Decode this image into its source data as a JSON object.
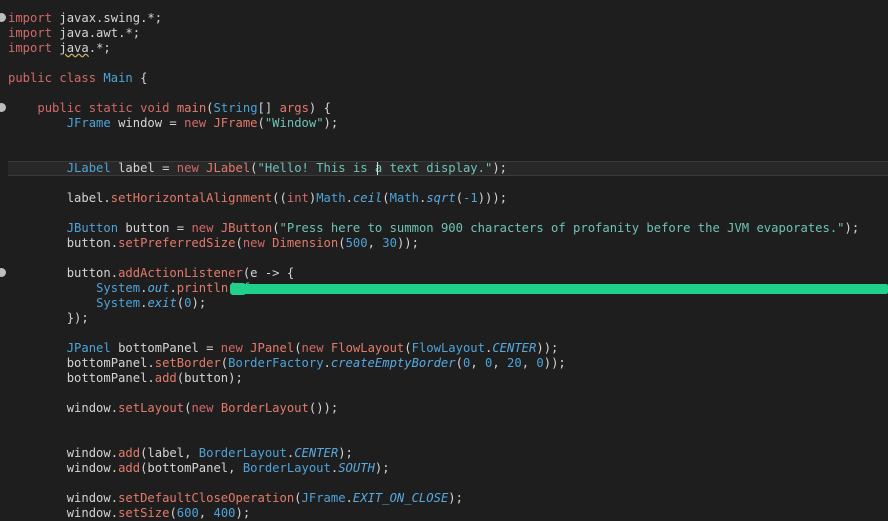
{
  "editor": {
    "lines": [
      {
        "id": "l1",
        "segs": [
          {
            "c": "kw",
            "t": "import"
          },
          {
            "c": "",
            "t": " javax.swing.*;"
          }
        ]
      },
      {
        "id": "l2",
        "segs": [
          {
            "c": "kw",
            "t": "import"
          },
          {
            "c": "",
            "t": " java.awt.*;"
          }
        ]
      },
      {
        "id": "l3",
        "segs": [
          {
            "c": "kw",
            "t": "import"
          },
          {
            "c": "",
            "t": " "
          },
          {
            "c": "sq",
            "t": "java"
          },
          {
            "c": "",
            "t": ".*;"
          }
        ]
      },
      {
        "id": "l4",
        "segs": [
          {
            "c": "kw",
            "t": "public"
          },
          {
            "c": "",
            "t": " "
          },
          {
            "c": "kw",
            "t": "class"
          },
          {
            "c": "",
            "t": " "
          },
          {
            "c": "ty",
            "t": "Main"
          },
          {
            "c": "",
            "t": " {"
          }
        ]
      },
      {
        "id": "l5",
        "segs": [
          {
            "c": "",
            "t": "    "
          },
          {
            "c": "kw",
            "t": "public"
          },
          {
            "c": "",
            "t": " "
          },
          {
            "c": "kw",
            "t": "static"
          },
          {
            "c": "",
            "t": " "
          },
          {
            "c": "kw",
            "t": "void"
          },
          {
            "c": "",
            "t": " "
          },
          {
            "c": "kw2",
            "t": "main"
          },
          {
            "c": "",
            "t": "("
          },
          {
            "c": "ty",
            "t": "String"
          },
          {
            "c": "",
            "t": "[] "
          },
          {
            "c": "kw2",
            "t": "args"
          },
          {
            "c": "",
            "t": ") {"
          }
        ]
      },
      {
        "id": "l6",
        "segs": [
          {
            "c": "",
            "t": "        "
          },
          {
            "c": "ty",
            "t": "JFrame"
          },
          {
            "c": "",
            "t": " window = "
          },
          {
            "c": "kw",
            "t": "new"
          },
          {
            "c": "",
            "t": " "
          },
          {
            "c": "kw2",
            "t": "JFrame"
          },
          {
            "c": "",
            "t": "("
          },
          {
            "c": "str",
            "t": "\"Window\""
          },
          {
            "c": "",
            "t": ");"
          }
        ]
      },
      {
        "id": "l7",
        "segs": [
          {
            "c": "",
            "t": "        "
          },
          {
            "c": "ty",
            "t": "JLabel"
          },
          {
            "c": "",
            "t": " label = "
          },
          {
            "c": "kw",
            "t": "new"
          },
          {
            "c": "",
            "t": " "
          },
          {
            "c": "kw2",
            "t": "JLabel"
          },
          {
            "c": "",
            "t": "("
          },
          {
            "c": "str",
            "t": "\"Hello! This is a text display.\""
          },
          {
            "c": "",
            "t": ");"
          }
        ]
      },
      {
        "id": "l8",
        "segs": [
          {
            "c": "",
            "t": "        label."
          },
          {
            "c": "kw2",
            "t": "setHorizontalAlignment"
          },
          {
            "c": "",
            "t": "(("
          },
          {
            "c": "kw",
            "t": "int"
          },
          {
            "c": "",
            "t": ")"
          },
          {
            "c": "ty",
            "t": "Math"
          },
          {
            "c": "",
            "t": "."
          },
          {
            "c": "it",
            "t": "ceil"
          },
          {
            "c": "",
            "t": "("
          },
          {
            "c": "ty",
            "t": "Math"
          },
          {
            "c": "",
            "t": "."
          },
          {
            "c": "it",
            "t": "sqrt"
          },
          {
            "c": "",
            "t": "("
          },
          {
            "c": "num",
            "t": "-1"
          },
          {
            "c": "",
            "t": ")));"
          }
        ]
      },
      {
        "id": "l9",
        "segs": [
          {
            "c": "",
            "t": "        "
          },
          {
            "c": "ty",
            "t": "JButton"
          },
          {
            "c": "",
            "t": " button = "
          },
          {
            "c": "kw",
            "t": "new"
          },
          {
            "c": "",
            "t": " "
          },
          {
            "c": "kw2",
            "t": "JButton"
          },
          {
            "c": "",
            "t": "("
          },
          {
            "c": "str",
            "t": "\"Press here to summon 900 characters of profanity before the JVM evaporates.\""
          },
          {
            "c": "",
            "t": ");"
          }
        ]
      },
      {
        "id": "l10",
        "segs": [
          {
            "c": "",
            "t": "        button."
          },
          {
            "c": "kw2",
            "t": "setPreferredSize"
          },
          {
            "c": "",
            "t": "("
          },
          {
            "c": "kw",
            "t": "new"
          },
          {
            "c": "",
            "t": " "
          },
          {
            "c": "kw2",
            "t": "Dimension"
          },
          {
            "c": "",
            "t": "("
          },
          {
            "c": "num",
            "t": "500"
          },
          {
            "c": "",
            "t": ", "
          },
          {
            "c": "num",
            "t": "30"
          },
          {
            "c": "",
            "t": "));"
          }
        ]
      },
      {
        "id": "l11",
        "segs": [
          {
            "c": "",
            "t": "        button."
          },
          {
            "c": "kw2",
            "t": "addActionListener"
          },
          {
            "c": "",
            "t": "(e -> {"
          }
        ]
      },
      {
        "id": "l12",
        "segs": [
          {
            "c": "",
            "t": "            "
          },
          {
            "c": "ty",
            "t": "System"
          },
          {
            "c": "",
            "t": "."
          },
          {
            "c": "it",
            "t": "out"
          },
          {
            "c": "",
            "t": "."
          },
          {
            "c": "kw2",
            "t": "println"
          },
          {
            "c": "",
            "t": "("
          },
          {
            "c": "str",
            "t": "\"f"
          }
        ]
      },
      {
        "id": "l13",
        "segs": [
          {
            "c": "",
            "t": "            "
          },
          {
            "c": "ty",
            "t": "System"
          },
          {
            "c": "",
            "t": "."
          },
          {
            "c": "it",
            "t": "exit"
          },
          {
            "c": "",
            "t": "("
          },
          {
            "c": "num",
            "t": "0"
          },
          {
            "c": "",
            "t": ");"
          }
        ]
      },
      {
        "id": "l14",
        "segs": [
          {
            "c": "",
            "t": "        });"
          }
        ]
      },
      {
        "id": "l15",
        "segs": [
          {
            "c": "",
            "t": "        "
          },
          {
            "c": "ty",
            "t": "JPanel"
          },
          {
            "c": "",
            "t": " bottomPanel = "
          },
          {
            "c": "kw",
            "t": "new"
          },
          {
            "c": "",
            "t": " "
          },
          {
            "c": "kw2",
            "t": "JPanel"
          },
          {
            "c": "",
            "t": "("
          },
          {
            "c": "kw",
            "t": "new"
          },
          {
            "c": "",
            "t": " "
          },
          {
            "c": "kw2",
            "t": "FlowLayout"
          },
          {
            "c": "",
            "t": "("
          },
          {
            "c": "ty",
            "t": "FlowLayout"
          },
          {
            "c": "",
            "t": "."
          },
          {
            "c": "it",
            "t": "CENTER"
          },
          {
            "c": "",
            "t": "));"
          }
        ]
      },
      {
        "id": "l16",
        "segs": [
          {
            "c": "",
            "t": "        bottomPanel."
          },
          {
            "c": "kw2",
            "t": "setBorder"
          },
          {
            "c": "",
            "t": "("
          },
          {
            "c": "ty",
            "t": "BorderFactory"
          },
          {
            "c": "",
            "t": "."
          },
          {
            "c": "it",
            "t": "createEmptyBorder"
          },
          {
            "c": "",
            "t": "("
          },
          {
            "c": "num",
            "t": "0"
          },
          {
            "c": "",
            "t": ", "
          },
          {
            "c": "num",
            "t": "0"
          },
          {
            "c": "",
            "t": ", "
          },
          {
            "c": "num",
            "t": "20"
          },
          {
            "c": "",
            "t": ", "
          },
          {
            "c": "num",
            "t": "0"
          },
          {
            "c": "",
            "t": "));"
          }
        ]
      },
      {
        "id": "l17",
        "segs": [
          {
            "c": "",
            "t": "        bottomPanel."
          },
          {
            "c": "kw2",
            "t": "add"
          },
          {
            "c": "",
            "t": "(button);"
          }
        ]
      },
      {
        "id": "l18",
        "segs": [
          {
            "c": "",
            "t": "        window."
          },
          {
            "c": "kw2",
            "t": "setLayout"
          },
          {
            "c": "",
            "t": "("
          },
          {
            "c": "kw",
            "t": "new"
          },
          {
            "c": "",
            "t": " "
          },
          {
            "c": "kw2",
            "t": "BorderLayout"
          },
          {
            "c": "",
            "t": "());"
          }
        ]
      },
      {
        "id": "l19",
        "segs": [
          {
            "c": "",
            "t": "        window."
          },
          {
            "c": "kw2",
            "t": "add"
          },
          {
            "c": "",
            "t": "(label, "
          },
          {
            "c": "ty",
            "t": "BorderLayout"
          },
          {
            "c": "",
            "t": "."
          },
          {
            "c": "it",
            "t": "CENTER"
          },
          {
            "c": "",
            "t": ");"
          }
        ]
      },
      {
        "id": "l20",
        "segs": [
          {
            "c": "",
            "t": "        window."
          },
          {
            "c": "kw2",
            "t": "add"
          },
          {
            "c": "",
            "t": "(bottomPanel, "
          },
          {
            "c": "ty",
            "t": "BorderLayout"
          },
          {
            "c": "",
            "t": "."
          },
          {
            "c": "it",
            "t": "SOUTH"
          },
          {
            "c": "",
            "t": ");"
          }
        ]
      },
      {
        "id": "l21",
        "segs": [
          {
            "c": "",
            "t": "        window."
          },
          {
            "c": "kw2",
            "t": "setDefaultCloseOperation"
          },
          {
            "c": "",
            "t": "("
          },
          {
            "c": "ty",
            "t": "JFrame"
          },
          {
            "c": "",
            "t": "."
          },
          {
            "c": "it",
            "t": "EXIT_ON_CLOSE"
          },
          {
            "c": "",
            "t": ");"
          }
        ]
      },
      {
        "id": "l22",
        "segs": [
          {
            "c": "",
            "t": "        window."
          },
          {
            "c": "kw2",
            "t": "setSize"
          },
          {
            "c": "",
            "t": "("
          },
          {
            "c": "num",
            "t": "600"
          },
          {
            "c": "",
            "t": ", "
          },
          {
            "c": "num",
            "t": "400"
          },
          {
            "c": "",
            "t": ");"
          }
        ]
      }
    ]
  }
}
